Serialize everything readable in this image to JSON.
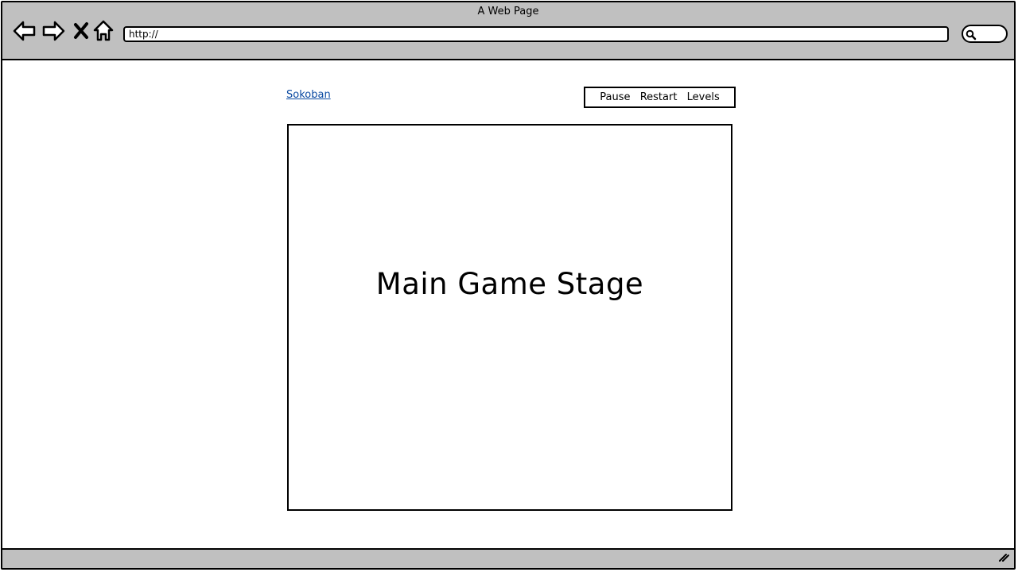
{
  "window": {
    "title": "A Web Page"
  },
  "toolbar": {
    "back_icon": "back-arrow-icon",
    "forward_icon": "forward-arrow-icon",
    "stop_icon": "close-icon",
    "home_icon": "home-icon",
    "url": "http://",
    "search_icon": "search-icon"
  },
  "header": {
    "brand": "Sokoban",
    "menu": {
      "pause": "Pause",
      "restart": "Restart",
      "levels": "Levels"
    }
  },
  "stage": {
    "label": "Main Game Stage"
  },
  "colors": {
    "chrome": "#c0c0c0",
    "link": "#0b4aa2",
    "border": "#000000"
  }
}
